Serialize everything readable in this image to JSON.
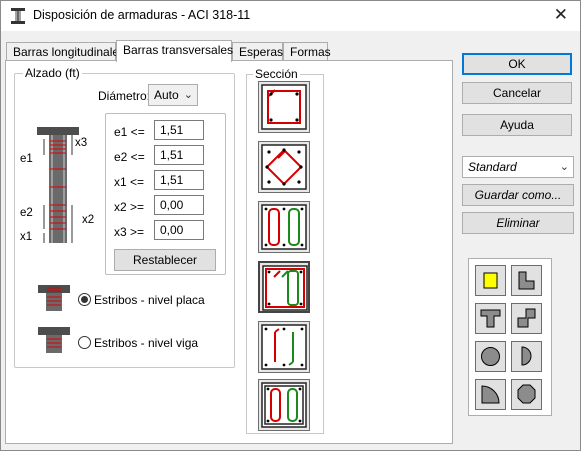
{
  "window": {
    "title": "Disposición de armaduras - ACI 318-11",
    "close_glyph": "✕"
  },
  "tabs": [
    "Barras longitudinales",
    "Barras transversales",
    "Esperas",
    "Formas"
  ],
  "alzado": {
    "legend": "Alzado (ft)",
    "diametro_label": "Diámetro:",
    "diametro_value": "Auto",
    "fields": [
      {
        "label": "e1 <=",
        "value": "1,51"
      },
      {
        "label": "e2 <=",
        "value": "1,51"
      },
      {
        "label": "x1 <=",
        "value": "1,51"
      },
      {
        "label": "x2 >=",
        "value": "0,00"
      },
      {
        "label": "x3 >=",
        "value": "0,00"
      }
    ],
    "diagram_labels": {
      "x3": "x3",
      "e1": "e1",
      "e2": "e2",
      "x2": "x2",
      "x1": "x1"
    },
    "reset_label": "Restablecer",
    "radio_placa": "Estribos - nivel placa",
    "radio_viga": "Estribos - nivel viga",
    "selected": "placa"
  },
  "seccion": {
    "legend": "Sección"
  },
  "right": {
    "ok": "OK",
    "cancel": "Cancelar",
    "help": "Ayuda",
    "preset_value": "Standard",
    "save_as": "Guardar como...",
    "delete": "Eliminar"
  },
  "colors": {
    "accent": "#0078d7",
    "rebar_red": "#d40000",
    "rebar_green": "#1a8a1a",
    "shape_yellow": "#ffff00"
  }
}
